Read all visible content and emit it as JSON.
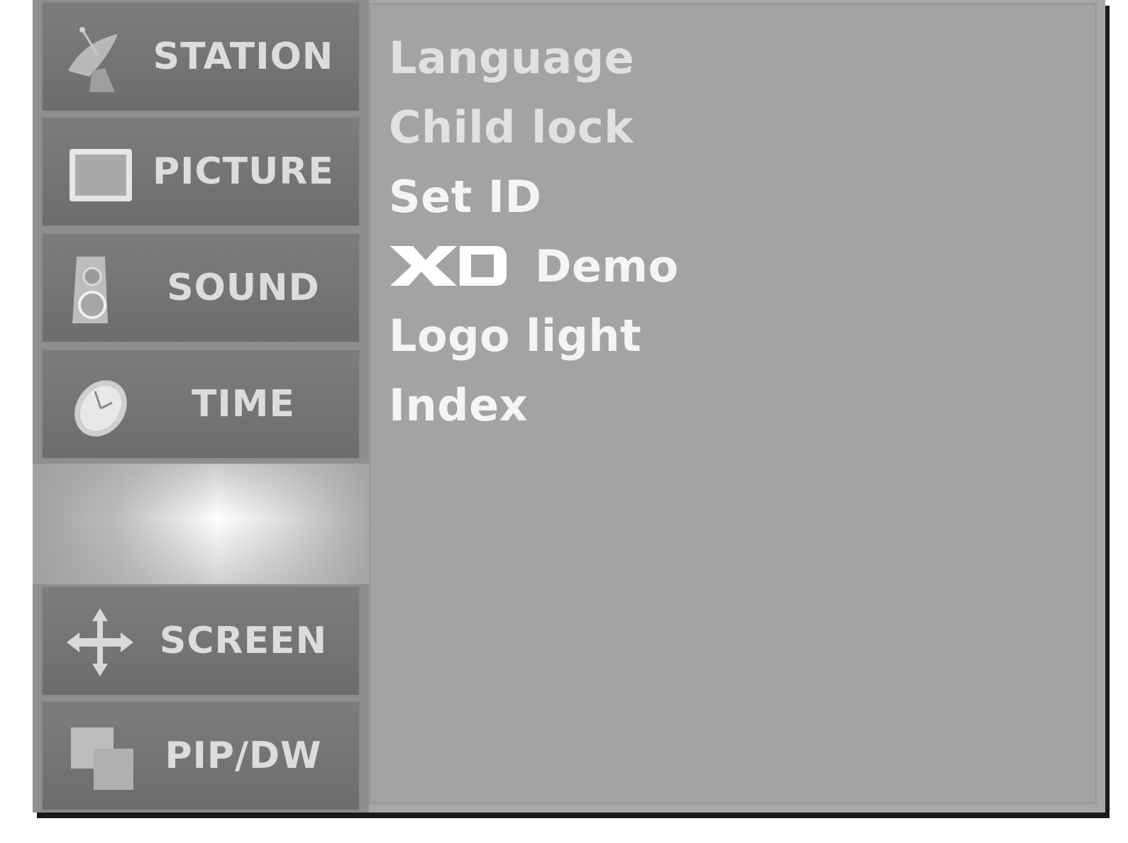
{
  "sidebar": {
    "items": [
      {
        "label": "STATION",
        "icon": "satellite-dish-icon"
      },
      {
        "label": "PICTURE",
        "icon": "picture-frame-icon"
      },
      {
        "label": "SOUND",
        "icon": "speaker-icon"
      },
      {
        "label": "TIME",
        "icon": "clock-icon"
      },
      {
        "label": "SCREEN",
        "icon": "move-arrows-icon"
      },
      {
        "label": "PIP/DW",
        "icon": "pip-windows-icon"
      }
    ]
  },
  "options": {
    "items": [
      {
        "label": "Language"
      },
      {
        "label": "Child lock"
      },
      {
        "label": "Set ID"
      },
      {
        "label": "Demo",
        "logo": "XD"
      },
      {
        "label": "Logo light"
      },
      {
        "label": "Index"
      }
    ]
  },
  "colors": {
    "panel": "#a3a3a3",
    "menu_item": "#747474",
    "text": "#f4f4f4"
  }
}
